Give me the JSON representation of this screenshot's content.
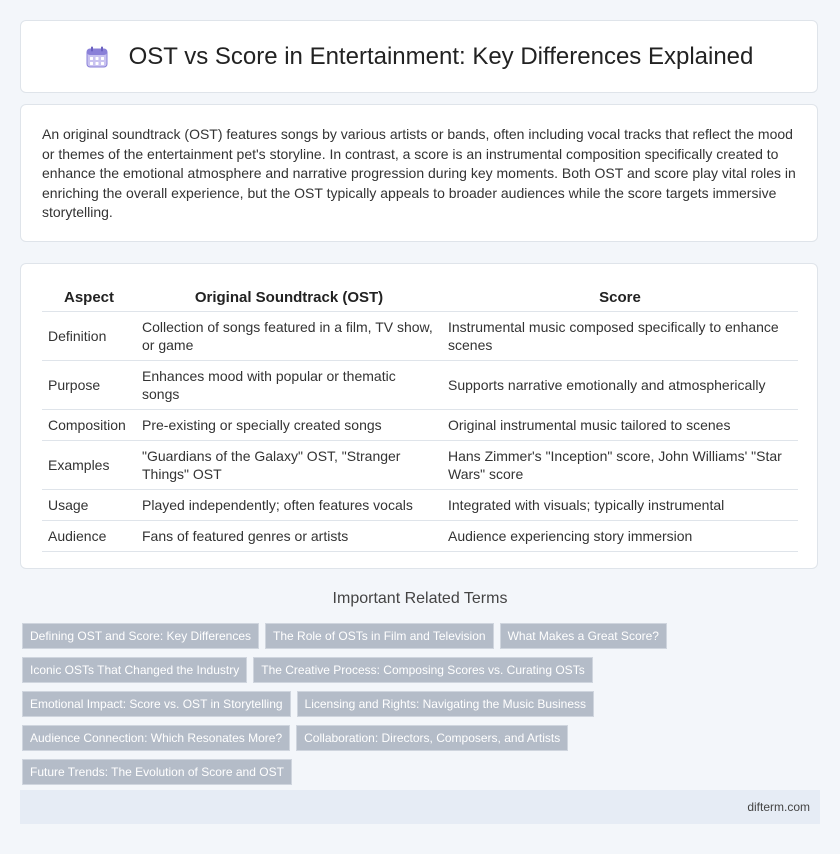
{
  "header": {
    "icon": "calendar-icon",
    "title": "OST vs Score in Entertainment: Key Differences Explained"
  },
  "intro": {
    "text": "An original soundtrack (OST) features songs by various artists or bands, often including vocal tracks that reflect the mood or themes of the entertainment pet's storyline. In contrast, a score is an instrumental composition specifically created to enhance the emotional atmosphere and narrative progression during key moments. Both OST and score play vital roles in enriching the overall experience, but the OST typically appeals to broader audiences while the score targets immersive storytelling."
  },
  "table": {
    "headers": [
      "Aspect",
      "Original Soundtrack (OST)",
      "Score"
    ],
    "rows": [
      [
        "Definition",
        "Collection of songs featured in a film, TV show, or game",
        "Instrumental music composed specifically to enhance scenes"
      ],
      [
        "Purpose",
        "Enhances mood with popular or thematic songs",
        "Supports narrative emotionally and atmospherically"
      ],
      [
        "Composition",
        "Pre-existing or specially created songs",
        "Original instrumental music tailored to scenes"
      ],
      [
        "Examples",
        "\"Guardians of the Galaxy\" OST, \"Stranger Things\" OST",
        "Hans Zimmer's \"Inception\" score, John Williams' \"Star Wars\" score"
      ],
      [
        "Usage",
        "Played independently; often features vocals",
        "Integrated with visuals; typically instrumental"
      ],
      [
        "Audience",
        "Fans of featured genres or artists",
        "Audience experiencing story immersion"
      ]
    ]
  },
  "related": {
    "title": "Important Related Terms",
    "tags": [
      "Defining OST and Score: Key Differences",
      "The Role of OSTs in Film and Television",
      "What Makes a Great Score?",
      "Iconic OSTs That Changed the Industry",
      "The Creative Process: Composing Scores vs. Curating OSTs",
      "Emotional Impact: Score vs. OST in Storytelling",
      "Licensing and Rights: Navigating the Music Business",
      "Audience Connection: Which Resonates More?",
      "Collaboration: Directors, Composers, and Artists",
      "Future Trends: The Evolution of Score and OST"
    ]
  },
  "footer": {
    "site": "difterm.com"
  }
}
